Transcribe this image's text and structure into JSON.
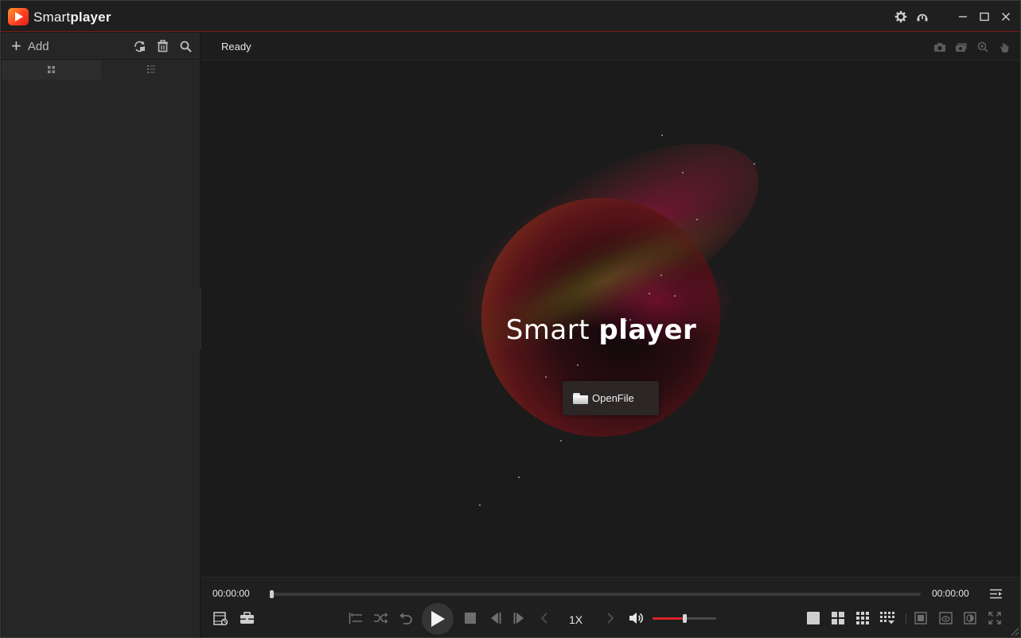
{
  "titlebar": {
    "app_name_light": "Smart",
    "app_name_bold": "player",
    "buttons": [
      "gear-icon",
      "headset-icon",
      "minimize-icon",
      "maximize-icon",
      "close-icon"
    ]
  },
  "sidebar": {
    "add_label": "Add",
    "tools": [
      "refresh-icon",
      "trash-icon",
      "search-icon"
    ],
    "view_tabs": [
      "grid-view-icon",
      "list-view-icon"
    ],
    "active_view": 0
  },
  "status": {
    "text": "Ready",
    "tools": [
      "camera-icon",
      "screenshots-icon",
      "zoom-icon",
      "hand-icon"
    ]
  },
  "splash": {
    "brand_light": "Smart",
    "brand_bold": "player",
    "open_button_label": "OpenFile"
  },
  "playback": {
    "current_time": "00:00:00",
    "total_time": "00:00:00",
    "progress": 0,
    "speed_label": "1X",
    "volume": 0.5
  },
  "colors": {
    "accent": "#d8232a",
    "background": "#1b1b1b",
    "sidebar": "#262626"
  }
}
